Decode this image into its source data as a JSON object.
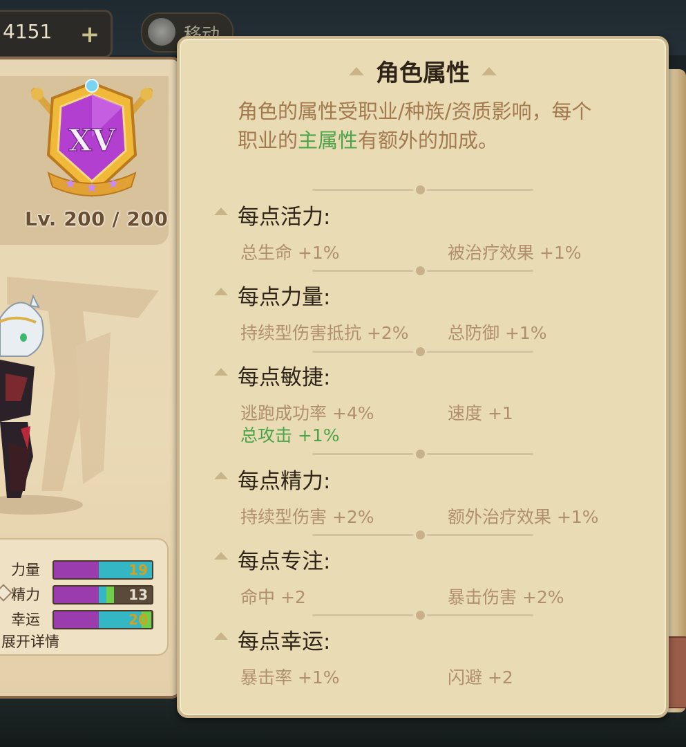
{
  "top_bar": {
    "currency_value": "4151",
    "plus_label": "+",
    "move_label": "移动"
  },
  "hero": {
    "rank_numeral": "XV",
    "stars": 3,
    "level_text": "Lv. 200 / 200"
  },
  "stats": {
    "rows": [
      {
        "label": "力量",
        "value": "19",
        "value_color": "#d4a020",
        "purple": 0.46,
        "teal": 0.54,
        "green": 0.0
      },
      {
        "label": "精力",
        "value": "13",
        "value_color": "#e8e0d0",
        "purple": 0.46,
        "teal": 0.08,
        "green": 0.08
      },
      {
        "label": "幸运",
        "value": "20",
        "value_color": "#d4a020",
        "purple": 0.46,
        "teal": 0.44,
        "green": 0.1
      }
    ],
    "expand_label": "展开详情"
  },
  "popup": {
    "title": "角色属性",
    "intro_part1": "角色的属性受职业/种族/资质影响，每个职业的",
    "intro_highlight": "主属性",
    "intro_part2": "有额外的加成。",
    "sections": [
      {
        "title": "每点活力:",
        "left": "总生命 +1%",
        "right": "被治疗效果 +1%",
        "extra": ""
      },
      {
        "title": "每点力量:",
        "left": "持续型伤害抵抗 +2%",
        "right": "总防御 +1%",
        "extra": ""
      },
      {
        "title": "每点敏捷:",
        "left": "逃跑成功率 +4%",
        "right": "速度 +1",
        "extra": "总攻击 +1%"
      },
      {
        "title": "每点精力:",
        "left": "持续型伤害 +2%",
        "right": "额外治疗效果 +1%",
        "extra": ""
      },
      {
        "title": "每点专注:",
        "left": "命中 +2",
        "right": "暴击伤害 +2%",
        "extra": ""
      },
      {
        "title": "每点幸运:",
        "left": "暴击率 +1%",
        "right": "闪避 +2",
        "extra": ""
      }
    ]
  },
  "colors": {
    "highlight_green": "#4aa54a",
    "attr_text": "#b08f6c",
    "title_text": "#2e2418"
  }
}
